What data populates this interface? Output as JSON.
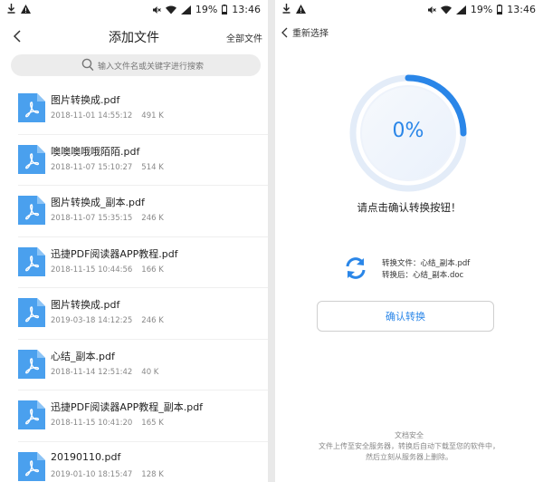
{
  "status": {
    "battery": "19%",
    "time": "13:46"
  },
  "left": {
    "title": "添加文件",
    "all_files": "全部文件",
    "search_placeholder": "输入文件名或关键字进行搜索",
    "files": [
      {
        "name": "图片转换成.pdf",
        "date": "2018-11-01 14:55:12",
        "size": "491 K"
      },
      {
        "name": "噢噢噢哦哦陌陌.pdf",
        "date": "2018-11-07 15:10:27",
        "size": "514 K"
      },
      {
        "name": "图片转换成_副本.pdf",
        "date": "2018-11-07 15:35:15",
        "size": "246 K"
      },
      {
        "name": "迅捷PDF阅读器APP教程.pdf",
        "date": "2018-11-15 10:44:56",
        "size": "166 K"
      },
      {
        "name": "图片转换成.pdf",
        "date": "2019-03-18 14:12:25",
        "size": "246 K"
      },
      {
        "name": "心结_副本.pdf",
        "date": "2018-11-14 12:51:42",
        "size": "40 K"
      },
      {
        "name": "迅捷PDF阅读器APP教程_副本.pdf",
        "date": "2018-11-15 10:41:20",
        "size": "165 K"
      },
      {
        "name": "20190110.pdf",
        "date": "2019-01-10 18:15:47",
        "size": "128 K"
      }
    ]
  },
  "right": {
    "back_label": "重新选择",
    "progress": 0,
    "progress_text": "0%",
    "prompt": "请点击确认转换按钮！",
    "convert_file": "转换文件：心结_副本.pdf",
    "converted_file": "转换后：心结_副本.doc",
    "confirm_label": "确认转换",
    "security_title": "文档安全",
    "security_line1": "文件上传至安全服务器，转换后自动下载至您的软件中，",
    "security_line2": "然后立刻从服务器上删除。"
  },
  "colors": {
    "accent": "#2a86e8",
    "file_icon": "#4aa0ee"
  }
}
